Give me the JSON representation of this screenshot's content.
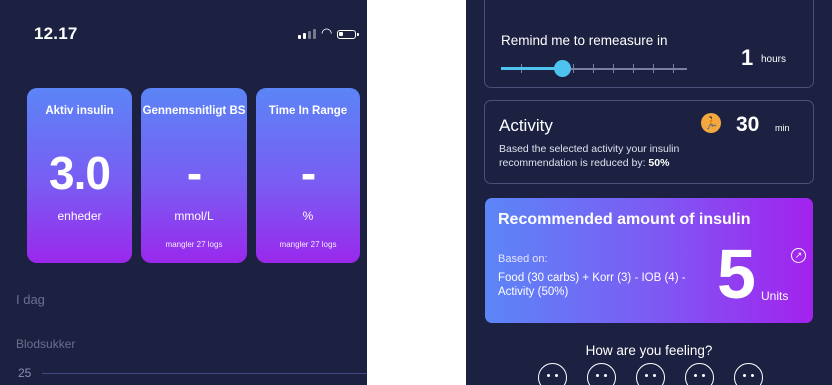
{
  "left_screen": {
    "status_bar": {
      "time": "12.17",
      "icons": [
        "signal-icon",
        "wifi-icon",
        "battery-icon"
      ]
    },
    "cards": [
      {
        "title": "Aktiv insulin",
        "value": "3.0",
        "unit": "enheder",
        "note": ""
      },
      {
        "title": "Gennemsnitligt BS",
        "value": "-",
        "unit": "mmol/L",
        "note": "mangler 27 logs"
      },
      {
        "title": "Time In Range",
        "value": "-",
        "unit": "%",
        "note": "mangler 27 logs"
      }
    ],
    "section_label": "I dag",
    "chart_label": "Blodsukker",
    "axis_value": "25"
  },
  "right_screen": {
    "remind": {
      "label": "Remind me to remeasure in",
      "value": "1",
      "unit": "hours",
      "slider_fraction": 0.3
    },
    "activity": {
      "title": "Activity",
      "icon": "running-icon",
      "value": "30",
      "unit": "min",
      "description": "Based the selected activity your insulin recommendation is reduced by: ",
      "reduction": "50%"
    },
    "recommendation": {
      "title": "Recommended amount of insulin",
      "based_on": "Based on:",
      "formula": "Food (30 carbs) + Korr (3) - IOB (4) - Activity (50%)",
      "value": "5",
      "unit": "Units"
    },
    "feeling": {
      "question": "How are you feeling?",
      "faces": 5
    },
    "colors": {
      "background": "#1c2142",
      "accent": "#4ec3f0",
      "activity_icon": "#f3a73f"
    }
  }
}
